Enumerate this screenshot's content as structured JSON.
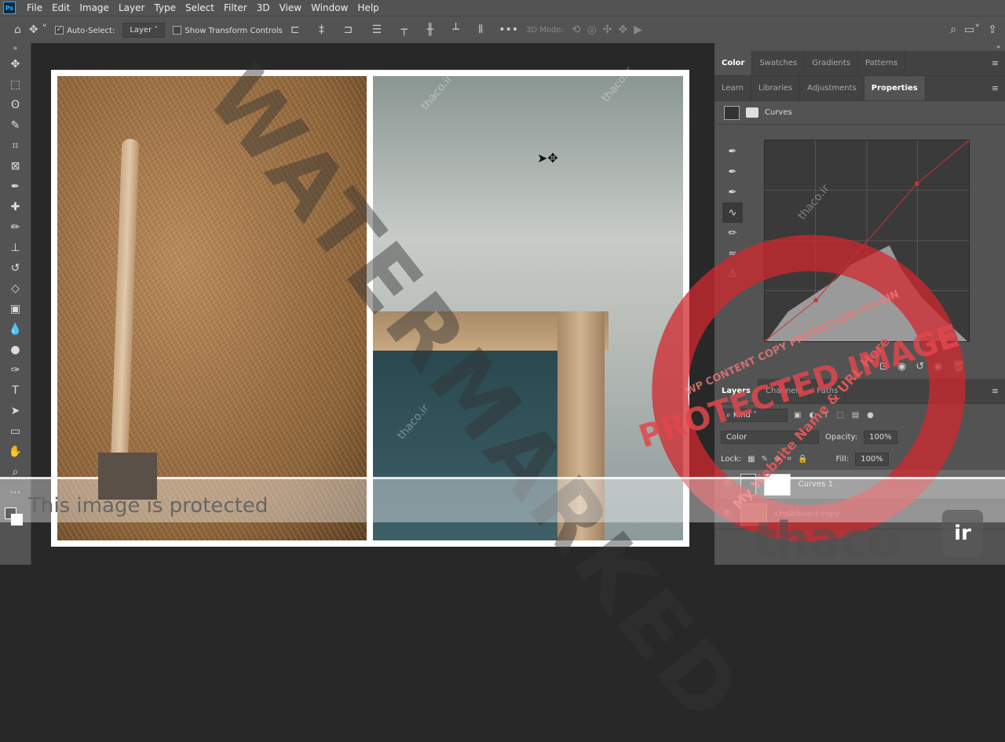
{
  "menu": [
    "File",
    "Edit",
    "Image",
    "Layer",
    "Type",
    "Select",
    "Filter",
    "3D",
    "View",
    "Window",
    "Help"
  ],
  "options": {
    "auto_select_label": "Auto-Select:",
    "auto_select_checked": true,
    "layer_select": "Layer",
    "show_transform_label": "Show Transform Controls",
    "show_transform_checked": false,
    "mode_3d": "3D Mode:"
  },
  "panels": {
    "top_tabs": [
      "Color",
      "Swatches",
      "Gradients",
      "Patterns"
    ],
    "top_active": "Color",
    "mid_tabs": [
      "Learn",
      "Libraries",
      "Adjustments",
      "Properties"
    ],
    "mid_active": "Properties",
    "properties_title": "Curves",
    "curve_points": [
      [
        0,
        0
      ],
      [
        64,
        52
      ],
      [
        190,
        200
      ],
      [
        255,
        255
      ]
    ],
    "layer_tabs": [
      "Layers",
      "Channels",
      "Paths"
    ],
    "filter_kind": "Kind",
    "blend_mode": "Color",
    "opacity_label": "Opacity:",
    "opacity": "100%",
    "lock_label": "Lock:",
    "fill_label": "Fill:",
    "fill": "100%",
    "layers": [
      {
        "name": "Curves 1",
        "visible": true
      },
      {
        "name": "chalkboard copy",
        "visible": true
      }
    ]
  },
  "watermarks": {
    "protected_text": "This image is protected",
    "diagonal": "WATERMARKED",
    "stamp_main": "PROTECTED IMAGE",
    "stamp_top": "WP CONTENT COPY PROTECTION PLUGIN",
    "stamp_sub": "My Website Name & URL Here",
    "brand": "thaco",
    "brand_suffix": "ir",
    "small": "thaco.ir"
  },
  "colors": {
    "stamp": "#d2282d",
    "ui_bg": "#535353",
    "canvas": "#282828"
  }
}
